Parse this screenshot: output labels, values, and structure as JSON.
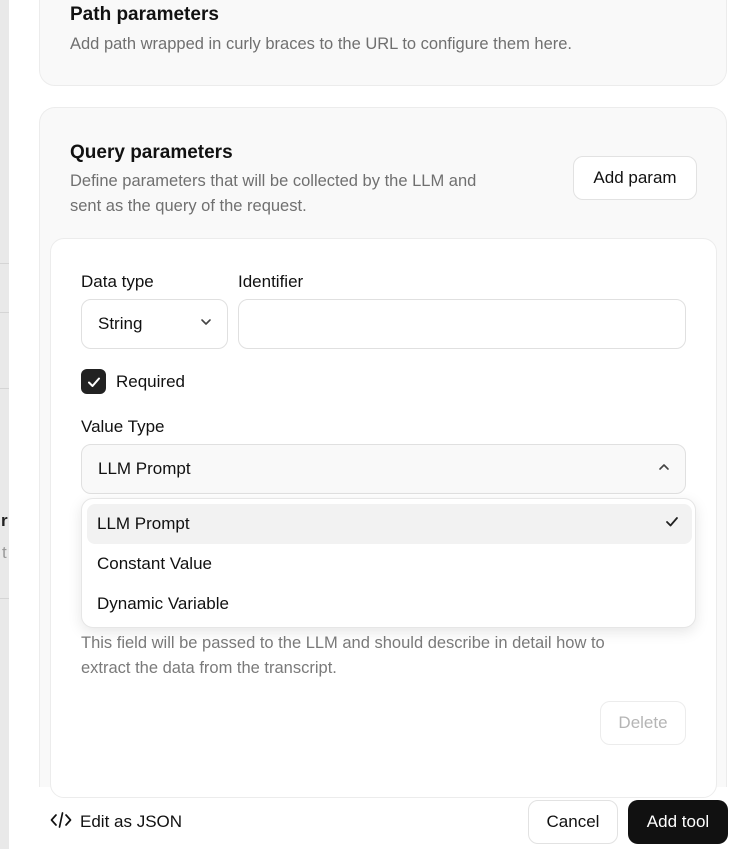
{
  "path_section": {
    "title": "Path parameters",
    "description": "Add path wrapped in curly braces to the URL to configure them here."
  },
  "query_section": {
    "title": "Query parameters",
    "description_line1": "Define parameters that will be collected by the LLM and",
    "description_line2": "sent as the query of the request.",
    "add_button": "Add param"
  },
  "param": {
    "data_type_label": "Data type",
    "data_type_value": "String",
    "identifier_label": "Identifier",
    "identifier_value": "",
    "required_label": "Required",
    "required_checked": true,
    "value_type_label": "Value Type",
    "value_type_value": "LLM Prompt",
    "hint_line1": "This field will be passed to the LLM and should describe in detail how to",
    "hint_line2": "extract the data from the transcript.",
    "delete_button": "Delete"
  },
  "dropdown": {
    "options": [
      "LLM Prompt",
      "Constant Value",
      "Dynamic Variable"
    ],
    "selected": "LLM Prompt"
  },
  "footer": {
    "edit_json": "Edit as JSON",
    "cancel": "Cancel",
    "add_tool": "Add tool"
  },
  "background": {
    "ghost_char_1": "r",
    "ghost_char_2": "t"
  }
}
